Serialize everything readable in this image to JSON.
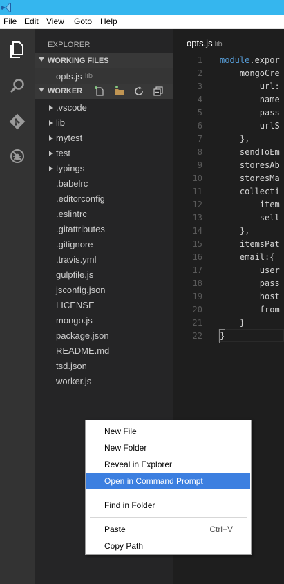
{
  "menubar": {
    "items": [
      "File",
      "Edit",
      "View",
      "Goto",
      "Help"
    ]
  },
  "sidebar": {
    "title": "EXPLORER",
    "working_files": {
      "header": "WORKING FILES",
      "file": {
        "name": "opts.js",
        "desc": "lib"
      }
    },
    "project": {
      "header": "WORKER",
      "toolbar_icons": [
        "new-file-icon",
        "new-folder-icon",
        "refresh-icon",
        "collapse-all-icon"
      ],
      "items": [
        {
          "label": ".vscode",
          "folder": true
        },
        {
          "label": "lib",
          "folder": true
        },
        {
          "label": "mytest",
          "folder": true
        },
        {
          "label": "test",
          "folder": true
        },
        {
          "label": "typings",
          "folder": true
        },
        {
          "label": ".babelrc",
          "folder": false
        },
        {
          "label": ".editorconfig",
          "folder": false
        },
        {
          "label": ".eslintrc",
          "folder": false
        },
        {
          "label": ".gitattributes",
          "folder": false
        },
        {
          "label": ".gitignore",
          "folder": false
        },
        {
          "label": ".travis.yml",
          "folder": false
        },
        {
          "label": "gulpfile.js",
          "folder": false
        },
        {
          "label": "jsconfig.json",
          "folder": false
        },
        {
          "label": "LICENSE",
          "folder": false
        },
        {
          "label": "mongo.js",
          "folder": false
        },
        {
          "label": "package.json",
          "folder": false
        },
        {
          "label": "README.md",
          "folder": false
        },
        {
          "label": "tsd.json",
          "folder": false
        },
        {
          "label": "worker.js",
          "folder": false
        }
      ]
    }
  },
  "activitybar": {
    "icons": [
      "files-icon",
      "search-icon",
      "git-icon",
      "debug-icon"
    ]
  },
  "editor": {
    "tab": {
      "name": "opts.js",
      "desc": "lib"
    },
    "line_numbers": [
      "1",
      "2",
      "3",
      "4",
      "5",
      "6",
      "7",
      "8",
      "9",
      "10",
      "11",
      "12",
      "13",
      "14",
      "15",
      "16",
      "17",
      "18",
      "19",
      "20",
      "21",
      "22"
    ],
    "lines": [
      "module.expor",
      "    mongoCre",
      "        url:",
      "        name",
      "        pass",
      "        urlS",
      "    },",
      "    sendToEm",
      "    storesAb",
      "    storesMa",
      "    collecti",
      "        item",
      "        sell",
      "    },",
      "    itemsPat",
      "    email:{",
      "        user",
      "        pass",
      "        host",
      "        from",
      "    }",
      "}"
    ]
  },
  "context_menu": {
    "items": [
      {
        "label": "New File",
        "shortcut": ""
      },
      {
        "label": "New Folder",
        "shortcut": ""
      },
      {
        "label": "Reveal in Explorer",
        "shortcut": ""
      },
      {
        "label": "Open in Command Prompt",
        "shortcut": "",
        "highlighted": true
      },
      {
        "label": "Find in Folder",
        "shortcut": ""
      },
      {
        "label": "Paste",
        "shortcut": "Ctrl+V"
      },
      {
        "label": "Copy Path",
        "shortcut": ""
      }
    ]
  },
  "colors": {
    "titlebar": "#35b6ee",
    "activitybar": "#333333",
    "sidebar": "#252526",
    "editor": "#1e1e1e",
    "menu_highlight": "#3c7fe0"
  }
}
